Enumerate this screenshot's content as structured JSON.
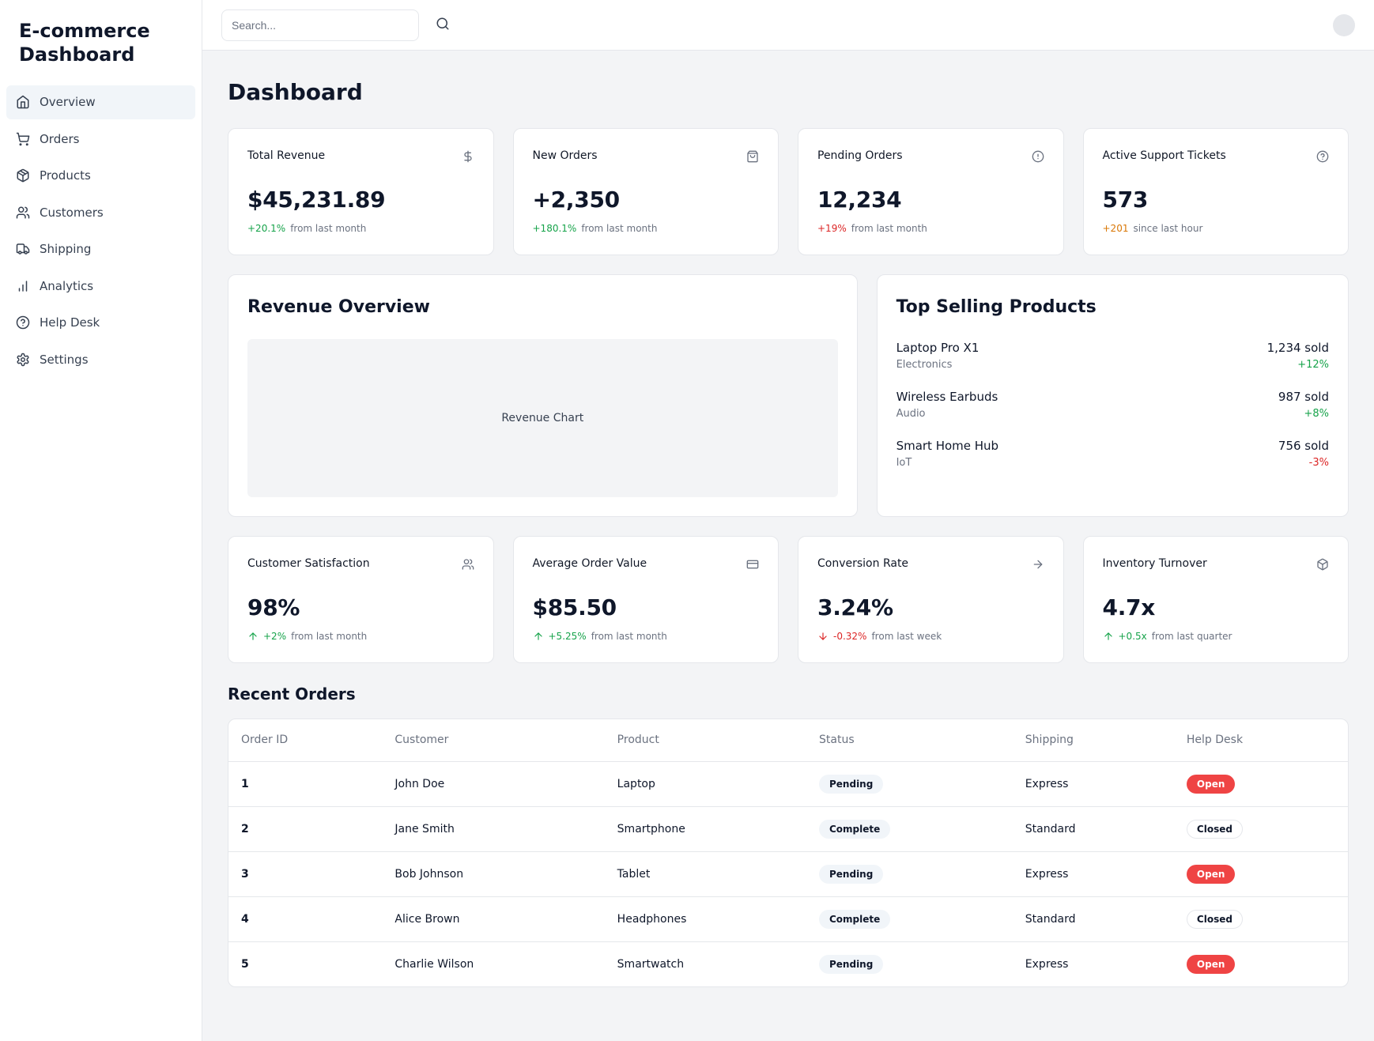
{
  "brand": {
    "title": "E-commerce Dashboard"
  },
  "search": {
    "placeholder": "Search..."
  },
  "sidebar": {
    "items": [
      {
        "label": "Overview"
      },
      {
        "label": "Orders"
      },
      {
        "label": "Products"
      },
      {
        "label": "Customers"
      },
      {
        "label": "Shipping"
      },
      {
        "label": "Analytics"
      },
      {
        "label": "Help Desk"
      },
      {
        "label": "Settings"
      }
    ]
  },
  "page": {
    "title": "Dashboard"
  },
  "statsTop": [
    {
      "title": "Total Revenue",
      "value": "$45,231.89",
      "deltaText": "+20.1%",
      "deltaClass": "delta-green",
      "note": "from last month"
    },
    {
      "title": "New Orders",
      "value": "+2,350",
      "deltaText": "+180.1%",
      "deltaClass": "delta-green",
      "note": "from last month"
    },
    {
      "title": "Pending Orders",
      "value": "12,234",
      "deltaText": "+19%",
      "deltaClass": "delta-red",
      "note": "from last month"
    },
    {
      "title": "Active Support Tickets",
      "value": "573",
      "deltaText": "+201",
      "deltaClass": "delta-amber",
      "note": "since last hour"
    }
  ],
  "revenue": {
    "title": "Revenue Overview",
    "chartLabel": "Revenue Chart"
  },
  "topProducts": {
    "title": "Top Selling Products",
    "items": [
      {
        "name": "Laptop Pro X1",
        "category": "Electronics",
        "sales": "1,234 sold",
        "change": "+12%",
        "changeClass": "delta-green"
      },
      {
        "name": "Wireless Earbuds",
        "category": "Audio",
        "sales": "987 sold",
        "change": "+8%",
        "changeClass": "delta-green"
      },
      {
        "name": "Smart Home Hub",
        "category": "IoT",
        "sales": "756 sold",
        "change": "-3%",
        "changeClass": "delta-red"
      }
    ]
  },
  "statsBottom": [
    {
      "title": "Customer Satisfaction",
      "value": "98%",
      "deltaText": "+2%",
      "arrow": "up",
      "note": "from last month"
    },
    {
      "title": "Average Order Value",
      "value": "$85.50",
      "deltaText": "+5.25%",
      "arrow": "up",
      "note": "from last month"
    },
    {
      "title": "Conversion Rate",
      "value": "3.24%",
      "deltaText": "-0.32%",
      "arrow": "down",
      "note": "from last week"
    },
    {
      "title": "Inventory Turnover",
      "value": "4.7x",
      "deltaText": "+0.5x",
      "arrow": "up",
      "note": "from last quarter"
    }
  ],
  "recent": {
    "title": "Recent Orders",
    "columns": [
      "Order ID",
      "Customer",
      "Product",
      "Status",
      "Shipping",
      "Help Desk"
    ],
    "rows": [
      {
        "id": "1",
        "customer": "John Doe",
        "product": "Laptop",
        "status": "Pending",
        "shipping": "Express",
        "help": "Open"
      },
      {
        "id": "2",
        "customer": "Jane Smith",
        "product": "Smartphone",
        "status": "Complete",
        "shipping": "Standard",
        "help": "Closed"
      },
      {
        "id": "3",
        "customer": "Bob Johnson",
        "product": "Tablet",
        "status": "Pending",
        "shipping": "Express",
        "help": "Open"
      },
      {
        "id": "4",
        "customer": "Alice Brown",
        "product": "Headphones",
        "status": "Complete",
        "shipping": "Standard",
        "help": "Closed"
      },
      {
        "id": "5",
        "customer": "Charlie Wilson",
        "product": "Smartwatch",
        "status": "Pending",
        "shipping": "Express",
        "help": "Open"
      }
    ]
  }
}
